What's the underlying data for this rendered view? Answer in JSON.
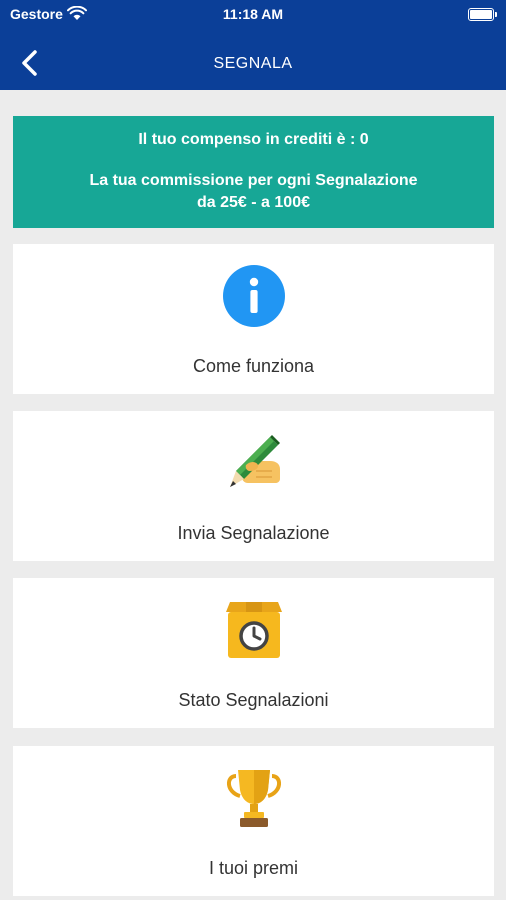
{
  "status_bar": {
    "carrier": "Gestore",
    "time": "11:18 AM"
  },
  "nav": {
    "title": "SEGNALA",
    "back_icon": "chevron-left-icon"
  },
  "banner": {
    "credits_text": "Il tuo compenso in crediti è : 0",
    "commission_text": "La tua commissione per ogni Segnalazione\nda 25€ - a 100€"
  },
  "menu": [
    {
      "label": "Come funziona",
      "icon": "info-icon"
    },
    {
      "label": "Invia Segnalazione",
      "icon": "pen-writing-icon"
    },
    {
      "label": "Stato Segnalazioni",
      "icon": "box-clock-icon"
    },
    {
      "label": "I tuoi premi",
      "icon": "trophy-icon"
    }
  ],
  "colors": {
    "header": "#0b3f98",
    "banner": "#17a796",
    "background": "#ececec",
    "info": "#2196f3"
  }
}
